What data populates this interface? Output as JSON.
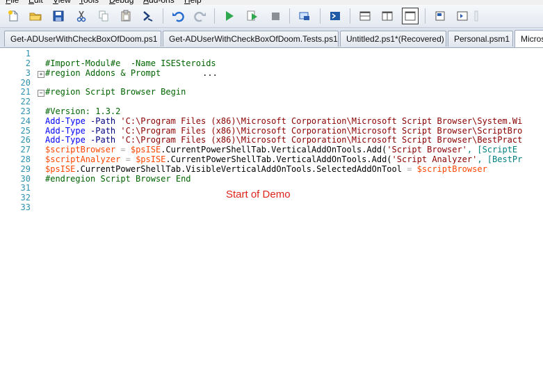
{
  "menu": [
    {
      "first": "F",
      "rest": "ile"
    },
    {
      "first": "E",
      "rest": "dit"
    },
    {
      "first": "V",
      "rest": "iew"
    },
    {
      "first": "T",
      "rest": "ools"
    },
    {
      "first": "D",
      "rest": "ebug"
    },
    {
      "first": "A",
      "rest": "dd-ons"
    },
    {
      "first": "H",
      "rest": "elp"
    }
  ],
  "toolbar_icons": [
    "new-file-icon",
    "open-folder-icon",
    "save-icon",
    "cut-icon",
    "copy-icon",
    "paste-icon",
    "console-icon",
    "undo-icon",
    "redo-icon",
    "run-icon",
    "run-selection-icon",
    "stop-icon",
    "new-remote-tab-icon",
    "start-powershell-icon",
    "script-pane-top-icon",
    "script-pane-right-icon",
    "script-pane-maximized-icon",
    "show-script-pane-icon",
    "show-command-addon-icon"
  ],
  "tabs": [
    "Get-ADUserWithCheckBoxOfDoom.ps1",
    "Get-ADUserWithCheckBoxOfDoom.Tests.ps1",
    "Untitled2.ps1*(Recovered)",
    "Personal.psm1",
    "Micros"
  ],
  "line_numbers": [
    "1",
    "2",
    "3",
    "20",
    "21",
    "22",
    "23",
    "24",
    "25",
    "26",
    "27",
    "28",
    "29",
    "30",
    "31",
    "32",
    "33"
  ],
  "code": {
    "l2": "#Import-Modul#e  -Name ISESteroids",
    "l3": "#region Addons & Prompt",
    "l3_collapsed": "...",
    "l21": "#region Script Browser Begin",
    "l23": "#Version: 1.3.2",
    "add_type": "Add-Type",
    "path_param": "-Path",
    "path24": "'C:\\Program Files (x86)\\Microsoft Corporation\\Microsoft Script Browser\\System.Wi",
    "path25": "'C:\\Program Files (x86)\\Microsoft Corporation\\Microsoft Script Browser\\ScriptBro",
    "path26": "'C:\\Program Files (x86)\\Microsoft Corporation\\Microsoft Script Browser\\BestPract",
    "var_sb": "$scriptBrowser",
    "var_sa": "$scriptAnalyzer",
    "var_psise": "$psISE",
    "eq": " = ",
    "mem27": ".CurrentPowerShellTab.VerticalAddOnTools.Add(",
    "str27": "'Script Browser'",
    "tail27": ", [ScriptE",
    "mem28": ".CurrentPowerShellTab.VerticalAddOnTools.Add(",
    "str28": "'Script Analyzer'",
    "tail28": ", [BestPr",
    "mem29": ".CurrentPowerShellTab.VisibleVerticalAddOnTools.SelectedAddOnTool",
    "l30": "#endregion Script Browser End"
  },
  "demo_label": "Start of Demo"
}
